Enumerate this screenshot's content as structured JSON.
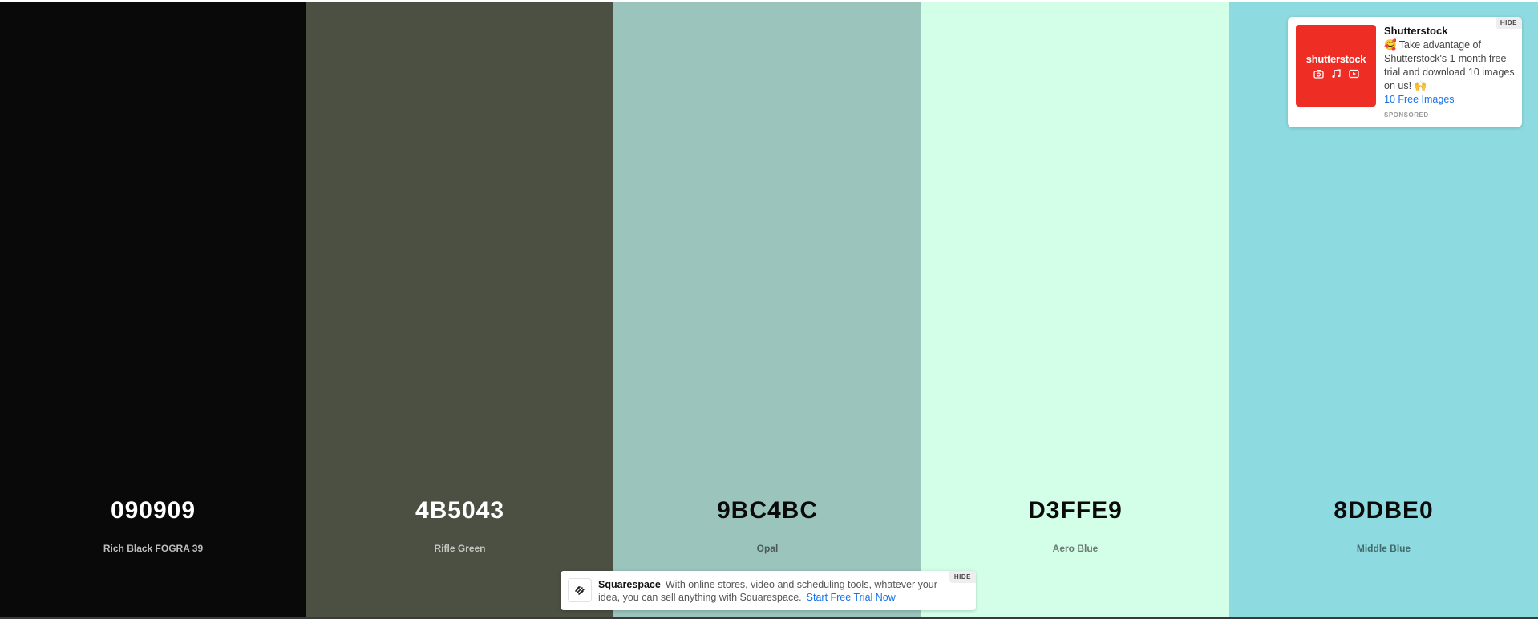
{
  "palette": [
    {
      "hex": "090909",
      "name": "Rich Black FOGRA 39",
      "color": "#090909",
      "hex_color": "#ffffff",
      "name_color": "#bdbdbd"
    },
    {
      "hex": "4B5043",
      "name": "Rifle Green",
      "color": "#4b5043",
      "hex_color": "#ffffff",
      "name_color": "#c4c6c0"
    },
    {
      "hex": "9BC4BC",
      "name": "Opal",
      "color": "#9bc4bc",
      "hex_color": "#0a0a0a",
      "name_color": "#4a5c59"
    },
    {
      "hex": "D3FFE9",
      "name": "Aero Blue",
      "color": "#d3ffe9",
      "hex_color": "#0a0a0a",
      "name_color": "#6b7a72"
    },
    {
      "hex": "8DDBE0",
      "name": "Middle Blue",
      "color": "#8ddbe0",
      "hex_color": "#0a0a0a",
      "name_color": "#436b6e"
    }
  ],
  "sponsor_card": {
    "brand_logo_text": "shutterstock",
    "thumb_icons": [
      "camera-icon",
      "music-note-icon",
      "video-play-icon"
    ],
    "title": "Shutterstock",
    "body": "🥰 Take advantage of Shutterstock's 1-month free trial and download 10 images on us! 🙌",
    "cta": "10 Free Images",
    "sponsored_label": "SPONSORED",
    "hide_label": "HIDE",
    "accent_color": "#ee2d24"
  },
  "bottom_ad": {
    "title": "Squarespace",
    "body": "With online stores, video and scheduling tools, whatever your idea, you can sell anything with Squarespace.",
    "cta": "Start Free Trial Now",
    "hide_label": "HIDE",
    "logo_icon": "squarespace-logo-icon"
  }
}
